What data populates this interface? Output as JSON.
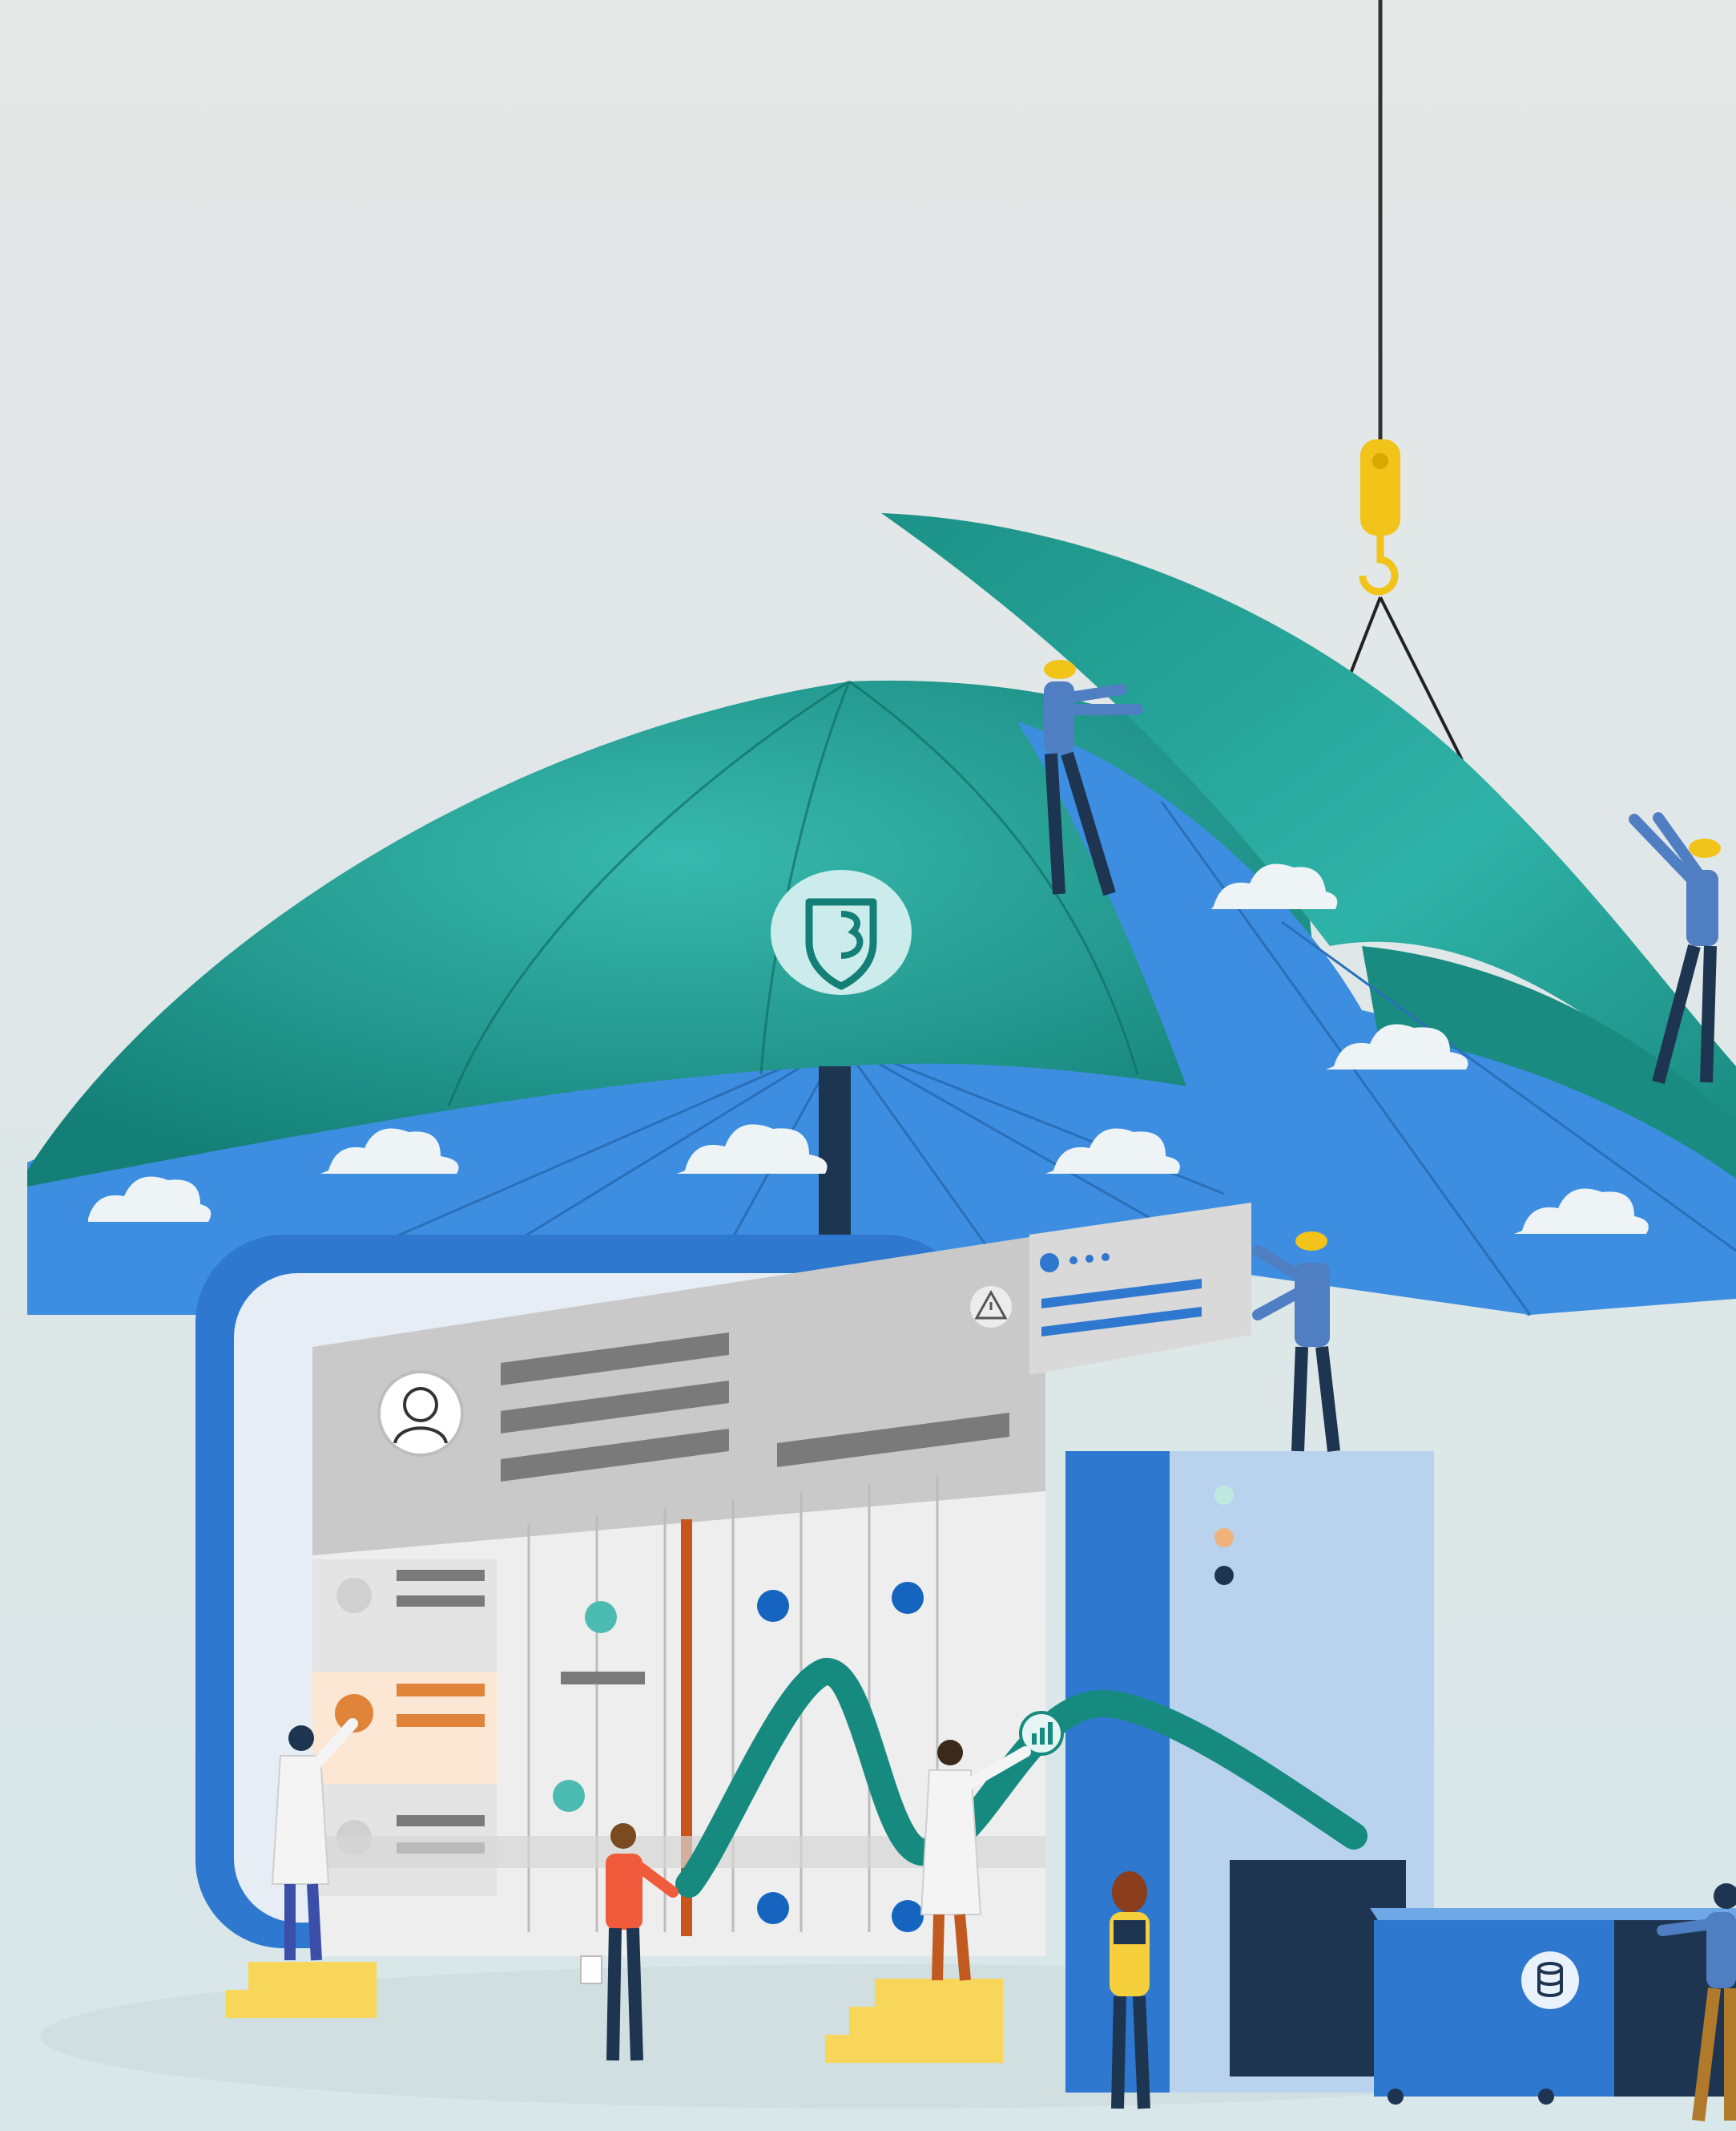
{
  "colors": {
    "accent_bar": "#0a6ed1",
    "background_top": "#e6e7e7",
    "background_bottom": "#d8e7e9",
    "umbrella_teal": "#1f9a8f",
    "umbrella_teal_dark": "#137f76",
    "umbrella_blue": "#3d8ee0",
    "device_blue": "#2e78cf",
    "device_light_blue": "#b9d3ef",
    "dark_navy": "#1d3550",
    "panel_grey": "#c9c9c9",
    "chart_line_teal": "#178a80",
    "chart_dot_blue": "#1565c0",
    "highlight_orange": "#e0843a",
    "hook_yellow": "#f2c318",
    "step_yellow": "#f8d65a"
  },
  "icons": [
    "shield-logo-icon",
    "user-avatar-icon",
    "warning-triangle-icon",
    "capsule-icon",
    "chart-icon",
    "database-icon",
    "crane-hook-icon"
  ]
}
